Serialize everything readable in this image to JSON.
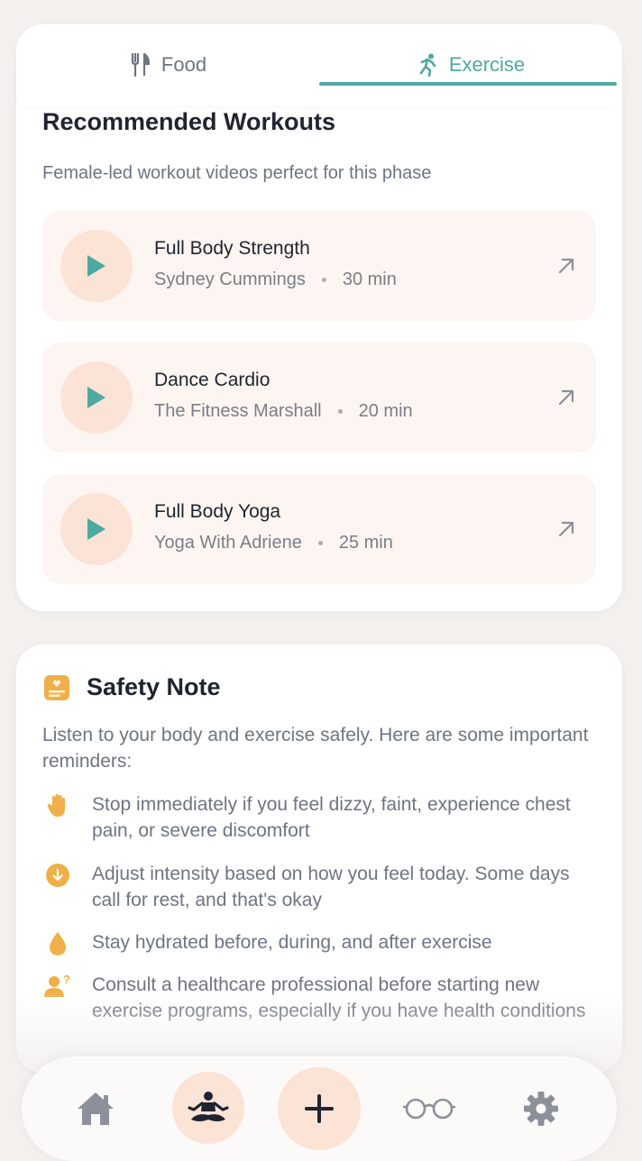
{
  "tabs": [
    {
      "label": "Food",
      "icon": "fork-knife-icon",
      "active": false
    },
    {
      "label": "Exercise",
      "icon": "running-icon",
      "active": true
    }
  ],
  "workouts_section": {
    "title": "Recommended Workouts",
    "subtitle": "Female-led workout videos perfect for this phase",
    "items": [
      {
        "title": "Full Body Strength",
        "instructor": "Sydney Cummings",
        "duration": "30 min"
      },
      {
        "title": "Dance Cardio",
        "instructor": "The Fitness Marshall",
        "duration": "20 min"
      },
      {
        "title": "Full Body Yoga",
        "instructor": "Yoga With Adriene",
        "duration": "25 min"
      }
    ]
  },
  "safety": {
    "title": "Safety Note",
    "intro": "Listen to your body and exercise safely. Here are some important reminders:",
    "reminders": [
      {
        "icon": "hand-stop-icon",
        "text": "Stop immediately if you feel dizzy, faint, experience chest pain, or severe discomfort"
      },
      {
        "icon": "arrow-down-circle-icon",
        "text": "Adjust intensity based on how you feel today. Some days call for rest, and that's okay"
      },
      {
        "icon": "water-drop-icon",
        "text": "Stay hydrated before, during, and after exercise"
      },
      {
        "icon": "person-question-icon",
        "text": "Consult a healthcare professional before starting new exercise programs, especially if you have health conditions"
      }
    ]
  },
  "bottom_nav": [
    {
      "icon": "home-icon"
    },
    {
      "icon": "meditation-icon"
    },
    {
      "icon": "plus-icon"
    },
    {
      "icon": "glasses-icon"
    },
    {
      "icon": "settings-gear-icon"
    }
  ],
  "colors": {
    "accent": "#4ea9a0",
    "peach": "#fbe3d5",
    "card_bg": "#fdf5f1",
    "warning": "#f0b049",
    "background": "#f3f0ee"
  }
}
